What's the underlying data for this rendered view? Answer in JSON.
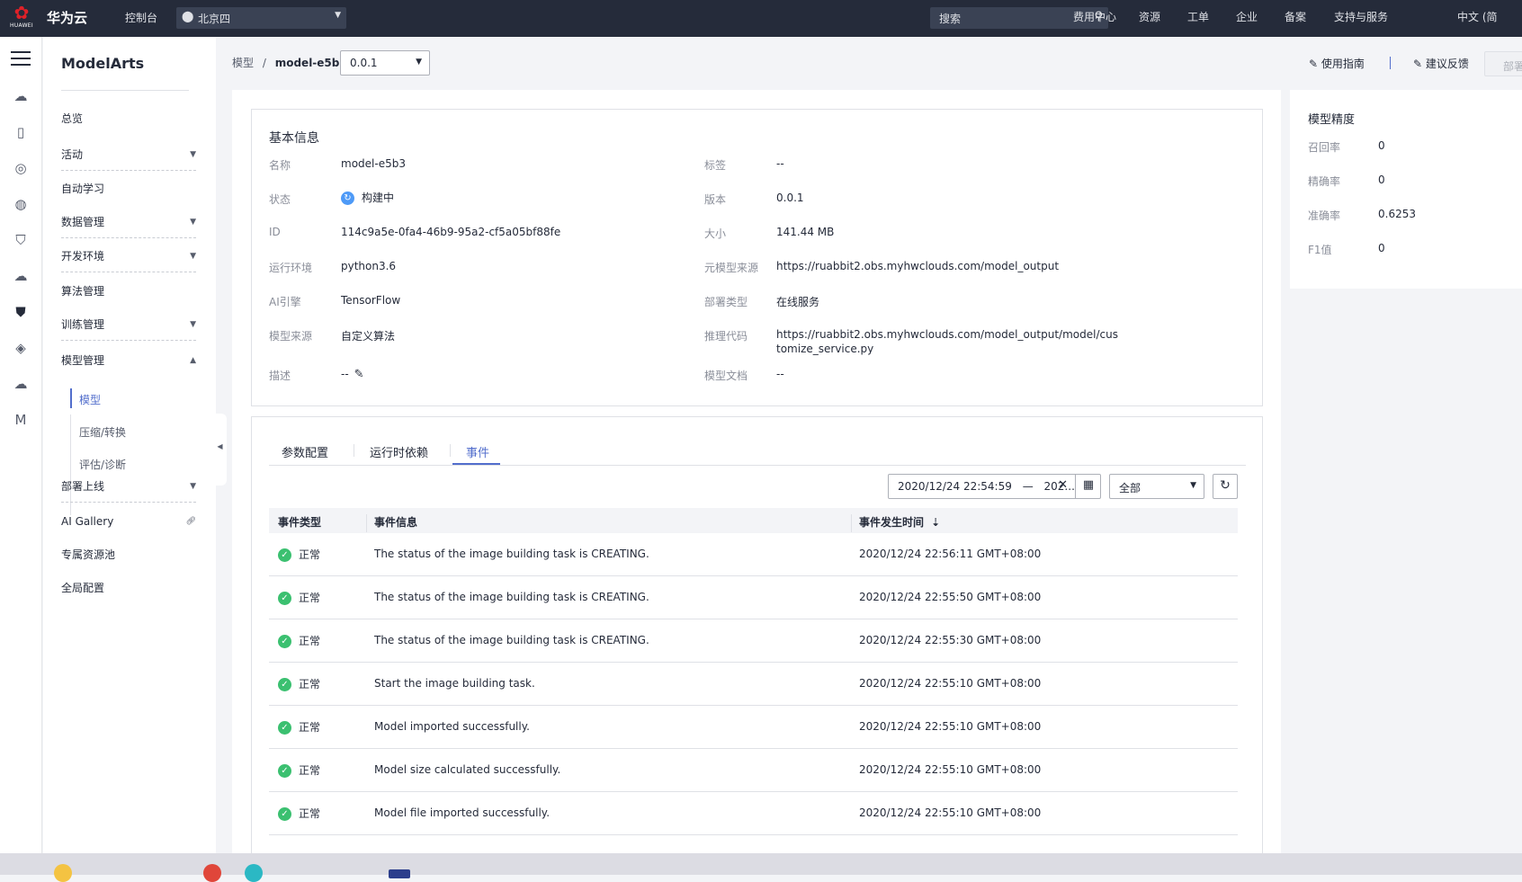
{
  "topbar": {
    "logo_text": "HUAWEI",
    "brand": "华为云",
    "console": "控制台",
    "region": "北京四",
    "search_placeholder": "搜索",
    "nav": [
      "费用中心",
      "资源",
      "工单",
      "企业",
      "备案",
      "支持与服务",
      "中文 (简"
    ]
  },
  "sidebar": {
    "title": "ModelArts",
    "items": [
      {
        "label": "总览"
      },
      {
        "label": "活动"
      },
      {
        "label": "自动学习"
      },
      {
        "label": "数据管理"
      },
      {
        "label": "开发环境"
      },
      {
        "label": "算法管理"
      },
      {
        "label": "训练管理"
      },
      {
        "label": "模型管理"
      },
      {
        "label": "部署上线"
      },
      {
        "label": "AI Gallery"
      },
      {
        "label": "专属资源池"
      },
      {
        "label": "全局配置"
      }
    ],
    "sub_items": [
      {
        "label": "模型"
      },
      {
        "label": "压缩/转换"
      },
      {
        "label": "评估/诊断"
      }
    ]
  },
  "header": {
    "breadcrumb_parent": "模型",
    "breadcrumb_sep": "/",
    "breadcrumb_current": "model-e5b3",
    "version": "0.0.1",
    "guide": "使用指南",
    "feedback": "建议反馈",
    "deploy": "部署"
  },
  "basic_info": {
    "title": "基本信息",
    "left": [
      {
        "label": "名称",
        "value": "model-e5b3"
      },
      {
        "label": "状态",
        "value": "构建中"
      },
      {
        "label": "ID",
        "value": "114c9a5e-0fa4-46b9-95a2-cf5a05bf88fe"
      },
      {
        "label": "运行环境",
        "value": "python3.6"
      },
      {
        "label": "AI引擎",
        "value": "TensorFlow"
      },
      {
        "label": "模型来源",
        "value": "自定义算法"
      },
      {
        "label": "描述",
        "value": "--"
      }
    ],
    "right": [
      {
        "label": "标签",
        "value": "--"
      },
      {
        "label": "版本",
        "value": "0.0.1"
      },
      {
        "label": "大小",
        "value": "141.44 MB"
      },
      {
        "label": "元模型来源",
        "value": "https://ruabbit2.obs.myhwclouds.com/model_output"
      },
      {
        "label": "部署类型",
        "value": "在线服务"
      },
      {
        "label": "推理代码",
        "value_line1": "https://ruabbit2.obs.myhwclouds.com/model_output/model/cus",
        "value_line2": "tomize_service.py"
      },
      {
        "label": "模型文档",
        "value": "--"
      }
    ]
  },
  "events": {
    "tabs": [
      "参数配置",
      "运行时依赖",
      "事件"
    ],
    "active_tab": "事件",
    "date_start": "2020/12/24 22:54:59",
    "date_sep": "—",
    "date_end": "202...",
    "type_filter": "全部",
    "columns": [
      "事件类型",
      "事件信息",
      "事件发生时间"
    ],
    "rows": [
      {
        "type": "正常",
        "info": "The status of the image building task is CREATING.",
        "time": "2020/12/24 22:56:11 GMT+08:00"
      },
      {
        "type": "正常",
        "info": "The status of the image building task is CREATING.",
        "time": "2020/12/24 22:55:50 GMT+08:00"
      },
      {
        "type": "正常",
        "info": "The status of the image building task is CREATING.",
        "time": "2020/12/24 22:55:30 GMT+08:00"
      },
      {
        "type": "正常",
        "info": "Start the image building task.",
        "time": "2020/12/24 22:55:10 GMT+08:00"
      },
      {
        "type": "正常",
        "info": "Model imported successfully.",
        "time": "2020/12/24 22:55:10 GMT+08:00"
      },
      {
        "type": "正常",
        "info": "Model size calculated successfully.",
        "time": "2020/12/24 22:55:10 GMT+08:00"
      },
      {
        "type": "正常",
        "info": "Model file imported successfully.",
        "time": "2020/12/24 22:55:10 GMT+08:00"
      }
    ]
  },
  "precision": {
    "title": "模型精度",
    "metrics": [
      {
        "label": "召回率",
        "value": "0"
      },
      {
        "label": "精确率",
        "value": "0"
      },
      {
        "label": "准确率",
        "value": "0.6253"
      },
      {
        "label": "F1值",
        "value": "0"
      }
    ]
  },
  "colors": {
    "topbar_bg": "#252b3a",
    "accent": "#526ecc",
    "status_building": "#4e9af7",
    "status_ok": "#3bc070"
  }
}
